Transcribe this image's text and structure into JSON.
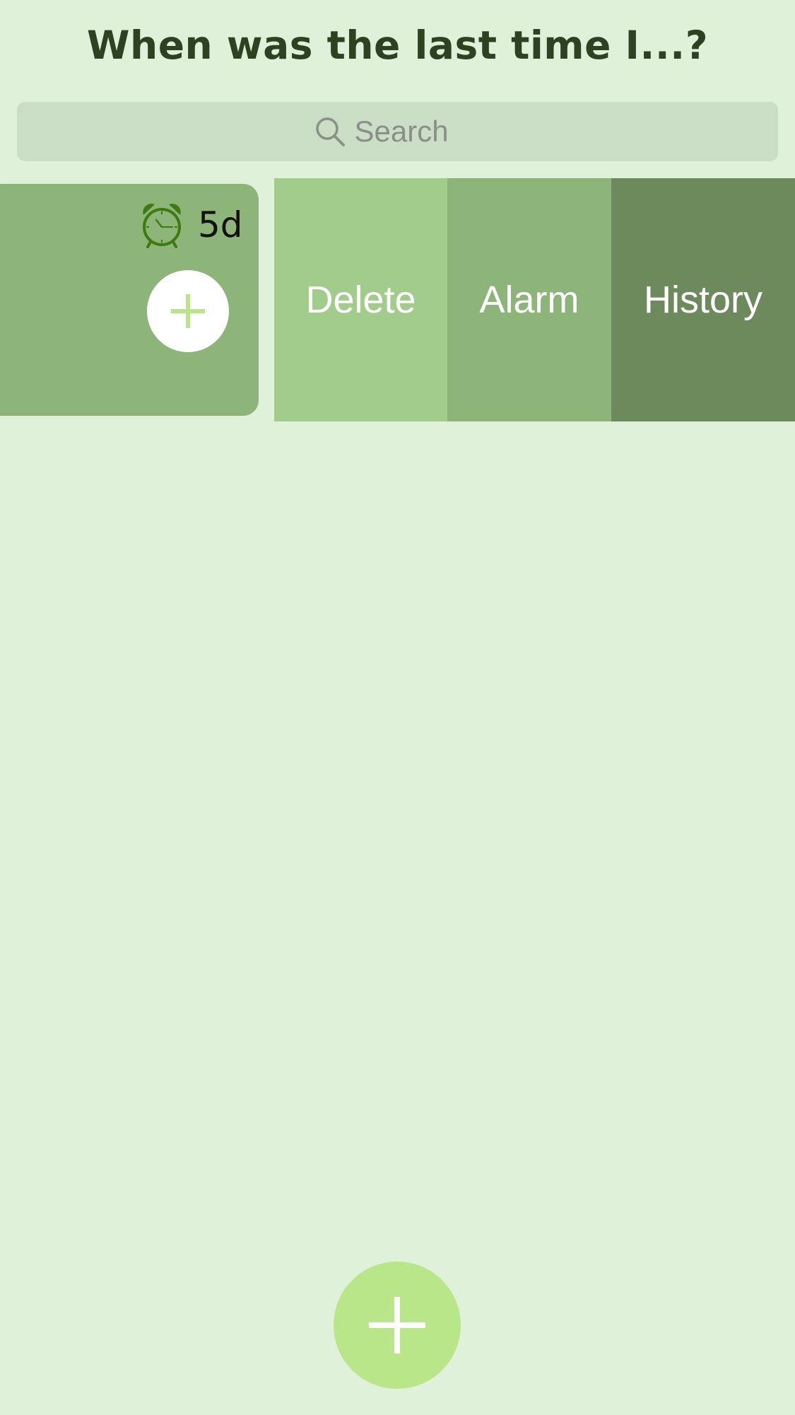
{
  "header": {
    "title": "When was the last time I...?"
  },
  "search": {
    "placeholder": "Search",
    "icon": "search-icon"
  },
  "items": [
    {
      "elapsed": "5d",
      "alarm_icon": "alarm-clock-icon",
      "add_icon": "plus-icon"
    }
  ],
  "swipe_actions": {
    "delete_label": "Delete",
    "alarm_label": "Alarm",
    "history_label": "History"
  },
  "fab": {
    "icon": "plus-icon"
  },
  "colors": {
    "background": "#dff1d8",
    "title": "#2e4222",
    "search_bg": "#c9dec4",
    "card": "#8db479",
    "alarm_icon": "#3d7a10",
    "delete": "#a2cc8c",
    "alarm": "#8db479",
    "history": "#6d8a5d",
    "fab": "#b8e688",
    "plus_light": "#b8e688"
  }
}
